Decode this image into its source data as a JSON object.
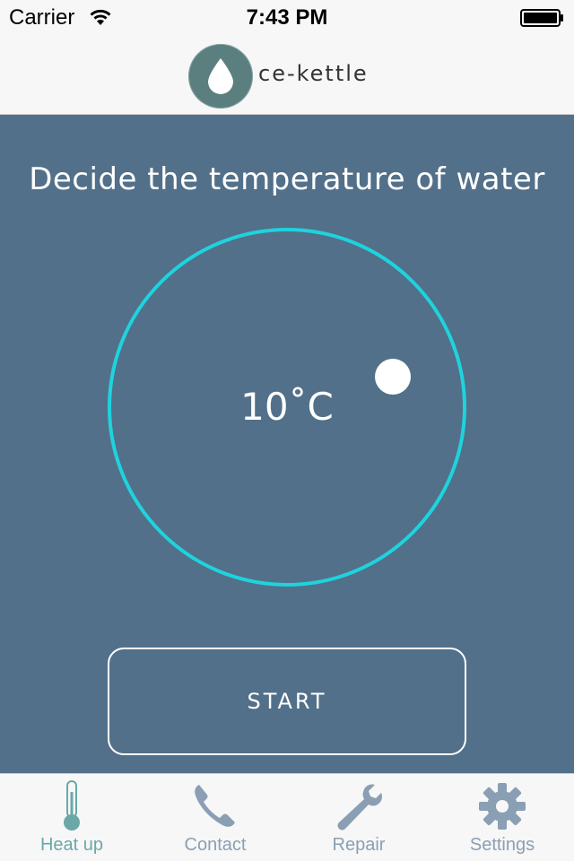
{
  "status_bar": {
    "carrier": "Carrier",
    "time": "7:43 PM",
    "icons": [
      "wifi-icon",
      "battery-icon"
    ]
  },
  "nav_bar": {
    "logo_icon": "water-drop-icon",
    "app_name": "ce-kettle"
  },
  "main": {
    "title": "Decide the temperature of water",
    "temperature_display": "10˚C",
    "start_label": "START"
  },
  "tabs": [
    {
      "label": "Heat up",
      "icon": "thermometer-icon",
      "active": true
    },
    {
      "label": "Contact",
      "icon": "phone-icon",
      "active": false
    },
    {
      "label": "Repair",
      "icon": "wrench-icon",
      "active": false
    },
    {
      "label": "Settings",
      "icon": "gear-icon",
      "active": false
    }
  ],
  "colors": {
    "main_background": "#527089",
    "ring": "#1ed3de",
    "active_tab": "#6aa8a8",
    "inactive_tab": "#8a9fb3",
    "logo_background": "#5a7f7e"
  }
}
